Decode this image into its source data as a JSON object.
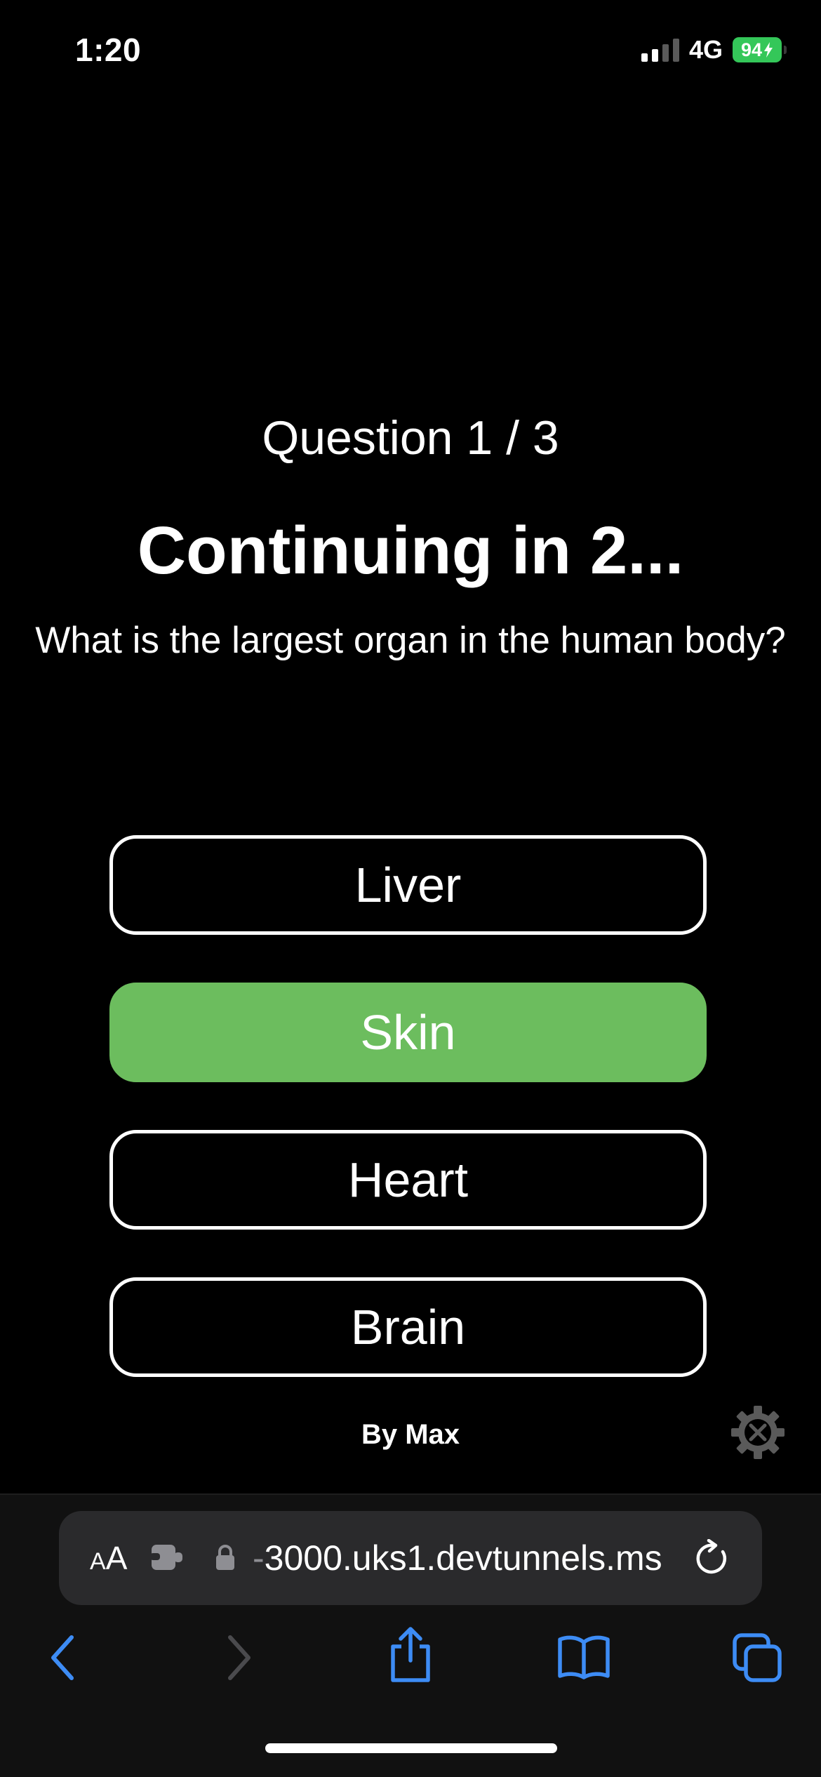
{
  "status_bar": {
    "time": "1:20",
    "network": "4G",
    "battery": "94"
  },
  "quiz": {
    "counter": "Question 1 / 3",
    "countdown": "Continuing in 2...",
    "question": "What is the largest organ in the human body?",
    "answers": [
      {
        "label": "Liver",
        "state": "default"
      },
      {
        "label": "Skin",
        "state": "correct"
      },
      {
        "label": "Heart",
        "state": "default"
      },
      {
        "label": "Brain",
        "state": "default"
      }
    ],
    "byline": "By Max"
  },
  "browser": {
    "text_size_label": "AA",
    "url": "3000.uks1.devtunnels.ms"
  },
  "colors": {
    "correct": "#6cbd5e",
    "accent": "#3d8cf5",
    "battery": "#34c759"
  },
  "icons": [
    "signal-icon",
    "battery-icon",
    "settings-gear-icon",
    "extension-icon",
    "lock-icon",
    "reload-icon",
    "back-icon",
    "forward-icon",
    "share-icon",
    "bookmarks-icon",
    "tabs-icon"
  ]
}
